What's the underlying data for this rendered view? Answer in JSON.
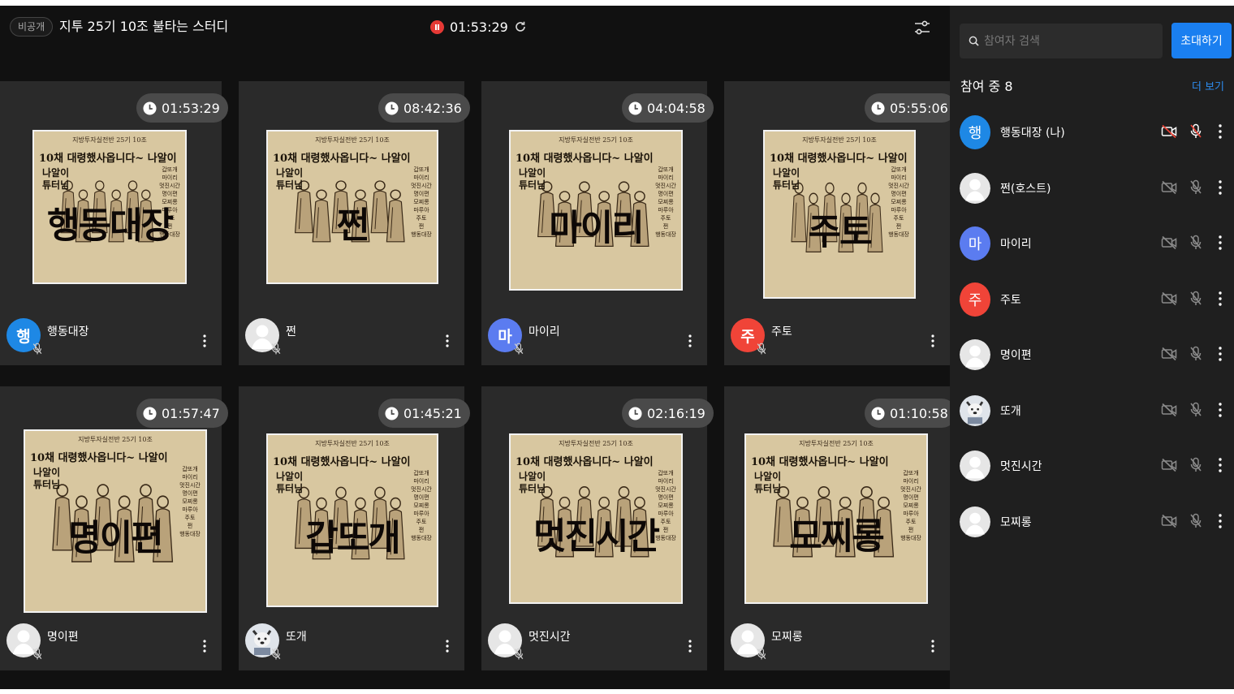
{
  "topbar": {
    "privacy_badge": "비공개",
    "room_title": "지투 25기 10조 불타는 스터디",
    "recording_time": "01:53:29"
  },
  "poster": {
    "header": "지방투자실전반 25기 10조",
    "headline": "10채 대령했사옵니다~ 나알이",
    "tutor_line1": "나알이",
    "tutor_line2": "튜터님",
    "names": [
      "갑또개",
      "마이리",
      "멋진시간",
      "명이편",
      "모찌롱",
      "마루아",
      "주토",
      "쩐",
      "행동대장"
    ]
  },
  "tiles": [
    {
      "name": "행동대장",
      "timer": "01:53:29",
      "poster_name": "행동대장",
      "avatar_text": "행",
      "avatar_color": "#1e88e5"
    },
    {
      "name": "쩐",
      "timer": "08:42:36",
      "poster_name": "쩐",
      "avatar_text": "",
      "avatar_color": "#e8e8e8"
    },
    {
      "name": "마이리",
      "timer": "04:04:58",
      "poster_name": "마이리",
      "avatar_text": "마",
      "avatar_color": "#5b7cf0"
    },
    {
      "name": "주토",
      "timer": "05:55:06",
      "poster_name": "주토",
      "avatar_text": "주",
      "avatar_color": "#f04438"
    },
    {
      "name": "명이편",
      "timer": "01:57:47",
      "poster_name": "명이편",
      "avatar_text": "",
      "avatar_color": "#e8e8e8"
    },
    {
      "name": "또개",
      "timer": "01:45:21",
      "poster_name": "갑또개",
      "avatar_text": "",
      "avatar_color": "#cfd6e0"
    },
    {
      "name": "멋진시간",
      "timer": "02:16:19",
      "poster_name": "멋진시간",
      "avatar_text": "",
      "avatar_color": "#e8e8e8"
    },
    {
      "name": "모찌롱",
      "timer": "01:10:58",
      "poster_name": "모찌롱",
      "avatar_text": "",
      "avatar_color": "#e8e8e8"
    }
  ],
  "sidebar": {
    "search_placeholder": "참여자 검색",
    "invite_label": "초대하기",
    "participant_count": "참여 중 8",
    "more_label": "더 보기",
    "participants": [
      {
        "name": "행동대장 (나)",
        "avatar_text": "행",
        "avatar_color": "#1e88e5"
      },
      {
        "name": "쩐(호스트)",
        "avatar_text": "",
        "avatar_color": "#e8e8e8"
      },
      {
        "name": "마이리",
        "avatar_text": "마",
        "avatar_color": "#5b7cf0"
      },
      {
        "name": "주토",
        "avatar_text": "주",
        "avatar_color": "#f04438"
      },
      {
        "name": "명이편",
        "avatar_text": "",
        "avatar_color": "#e8e8e8"
      },
      {
        "name": "또개",
        "avatar_text": "",
        "avatar_color": "#cfd6e0"
      },
      {
        "name": "멋진시간",
        "avatar_text": "",
        "avatar_color": "#e8e8e8"
      },
      {
        "name": "모찌롱",
        "avatar_text": "",
        "avatar_color": "#e8e8e8"
      }
    ]
  },
  "icons": {
    "recording": "record-pause-icon",
    "refresh": "refresh-icon",
    "settings": "sliders-icon",
    "timer": "clock-icon",
    "mic": "mic-off-icon",
    "camera": "camera-off-icon",
    "more": "more-vertical-icon",
    "search": "search-icon"
  },
  "colors": {
    "accent": "#1a7ff0",
    "recording": "#e53935",
    "background": "#111111",
    "tile": "#2a2a2a",
    "sidebar": "#1f1f1f"
  }
}
